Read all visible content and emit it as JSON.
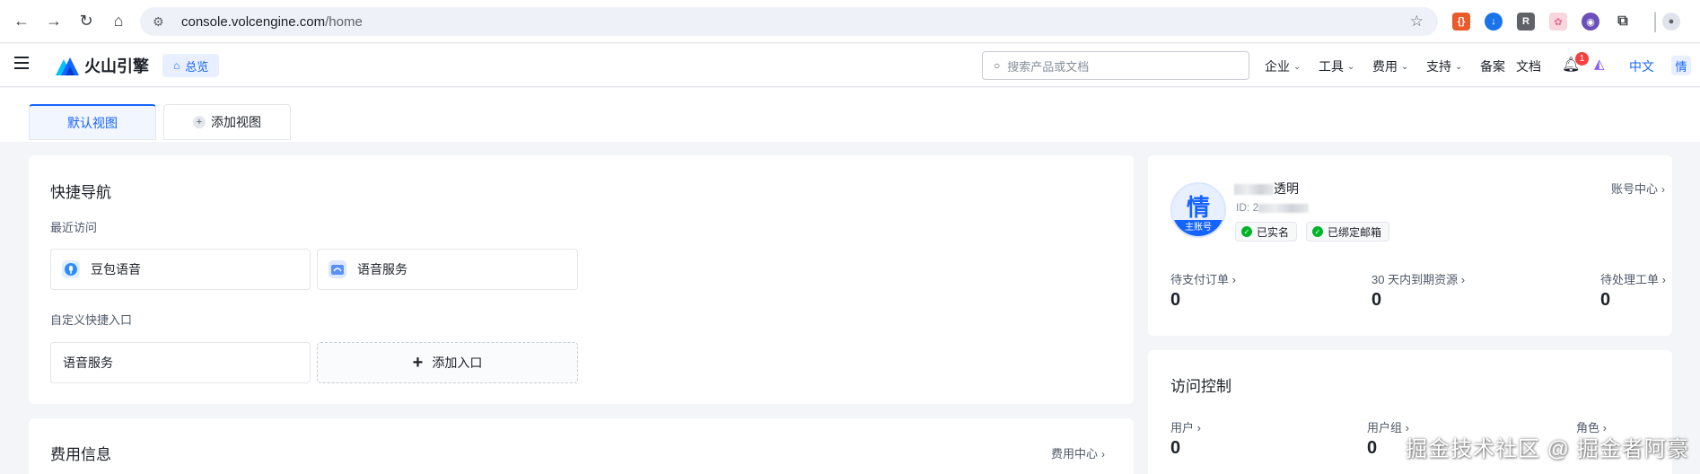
{
  "browser": {
    "url_host": "console.volcengine.com",
    "url_path": "/home",
    "extensions": [
      {
        "name": "code-extension-icon",
        "glyph": "{·}",
        "color": "#ea5a2a"
      },
      {
        "name": "download-extension-icon",
        "glyph": "↓",
        "color": "#1a73e8"
      },
      {
        "name": "r-extension-icon",
        "glyph": "R",
        "color": "#5f6368"
      },
      {
        "name": "pink-extension-icon",
        "glyph": "✿",
        "color": "#f4b6c2"
      },
      {
        "name": "purple-extension-icon",
        "glyph": "◉",
        "color": "#6b4fbb"
      }
    ]
  },
  "header": {
    "logo_text": "火山引擎",
    "overview_label": "总览",
    "search_placeholder": "搜索产品或文档",
    "menus": [
      "企业",
      "工具",
      "费用",
      "支持"
    ],
    "links": [
      "备案",
      "文档"
    ],
    "notification_count": "1",
    "language": "中文",
    "avatar_char": "情"
  },
  "view_tabs": {
    "default": "默认视图",
    "add": "添加视图"
  },
  "quick_nav": {
    "title": "快捷导航",
    "recent_label": "最近访问",
    "recent": [
      "豆包语音",
      "语音服务"
    ],
    "custom_label": "自定义快捷入口",
    "custom": [
      "语音服务"
    ],
    "add_entry": "添加入口"
  },
  "billing": {
    "title": "费用信息",
    "center_link": "费用中心"
  },
  "account": {
    "avatar_char": "情",
    "avatar_badge": "主账号",
    "name_suffix": "透明",
    "id_prefix": "ID: 2",
    "center_link": "账号中心",
    "tags": [
      "已实名",
      "已绑定邮箱"
    ],
    "stats": [
      {
        "label": "待支付订单",
        "value": "0"
      },
      {
        "label": "30 天内到期资源",
        "value": "0"
      },
      {
        "label": "待处理工单",
        "value": "0"
      }
    ]
  },
  "access_control": {
    "title": "访问控制",
    "stats": [
      {
        "label": "用户",
        "value": "0"
      },
      {
        "label": "用户组",
        "value": "0"
      },
      {
        "label": "角色",
        "value": ""
      }
    ]
  },
  "watermark": "掘金技术社区 @ 掘金者阿豪",
  "colors": {
    "accent": "#1664ff",
    "success": "#00b42a",
    "badge": "#f53f3f"
  }
}
